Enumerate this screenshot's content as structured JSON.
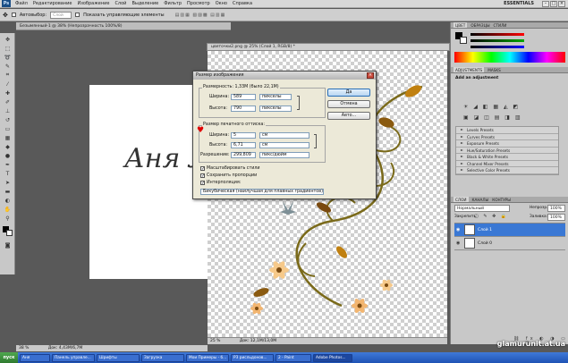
{
  "menu": {
    "app_icon": "Ps",
    "items": [
      "Файл",
      "Редактирование",
      "Изображение",
      "Слой",
      "Выделение",
      "Фильтр",
      "Просмотр",
      "Окно",
      "Справка"
    ],
    "workspace": "ESSENTIALS"
  },
  "options_bar": {
    "autoselect_label": "Автовыбор:",
    "autoselect_value": "Слой",
    "transform_label": "Показать управляющие элементы"
  },
  "doc1": {
    "tab_title": "Безымянный-1 @ 38% (Непрозрачность 100%/8)",
    "text": "Аня Л",
    "zoom": "38 %",
    "status": "Док: 4,43М/6,7М"
  },
  "doc2": {
    "tab_title": "цветочки2.png @ 25% (Слой 1, RGB/8) *",
    "zoom": "25 %",
    "status": "Док: 12,1М/13,0М"
  },
  "dialog": {
    "title": "Размер изображения",
    "pixel_dims_label": "Размерность: 1,33М (было 22,1М)",
    "width_label": "Ширина:",
    "width_value": "589",
    "width_unit": "пикселы",
    "height_label": "Высота:",
    "height_value": "790",
    "height_unit": "пикселы",
    "print_section": "Размер печатного оттиска:",
    "print_width_label": "Ширина:",
    "print_width_value": "5",
    "print_width_unit": "см",
    "print_height_label": "Высота:",
    "print_height_value": "6,71",
    "print_height_unit": "см",
    "resolution_label": "Разрешение:",
    "resolution_value": "299,809",
    "resolution_unit": "пикс/дюйм",
    "scale_styles": "Масштабировать стили",
    "constrain": "Сохранить пропорции",
    "resample": "Интерполяция:",
    "method": "Бикубическая (наилучшая для плавных градиентов)",
    "ok": "Да",
    "cancel": "Отмена",
    "auto": "Авто..."
  },
  "panels": {
    "color_tabs": [
      "ЦВЕТ",
      "ОБРАЗЦЫ",
      "СТИЛИ"
    ],
    "adj_tabs": [
      "ADJUSTMENTS",
      "MASKS"
    ],
    "adj_title": "Add an adjustment",
    "presets": [
      "Levels Presets",
      "Curves Presets",
      "Exposure Presets",
      "Hue/Saturation Presets",
      "Black & White Presets",
      "Channel Mixer Presets",
      "Selective Color Presets"
    ],
    "layers_tabs": [
      "СЛОИ",
      "КАНАЛЫ",
      "КОНТУРЫ"
    ],
    "blend_mode": "Нормальный",
    "opacity_label": "Непрозр.:",
    "opacity_value": "100%",
    "lock_label": "Закрепить:",
    "fill_label": "Заливка:",
    "fill_value": "100%",
    "layers": [
      "Слой 1",
      "Слой 0"
    ]
  },
  "taskbar": {
    "start": "пуск",
    "tasks": [
      "Аня",
      "Панель управле...",
      "Шрифты",
      "Загрузка",
      "Мои Примеры - б...",
      "РЗ рисльдонов...",
      "2 - Paint",
      "Adobe Photos..."
    ]
  },
  "watermark": "glamurunit.at.ua"
}
